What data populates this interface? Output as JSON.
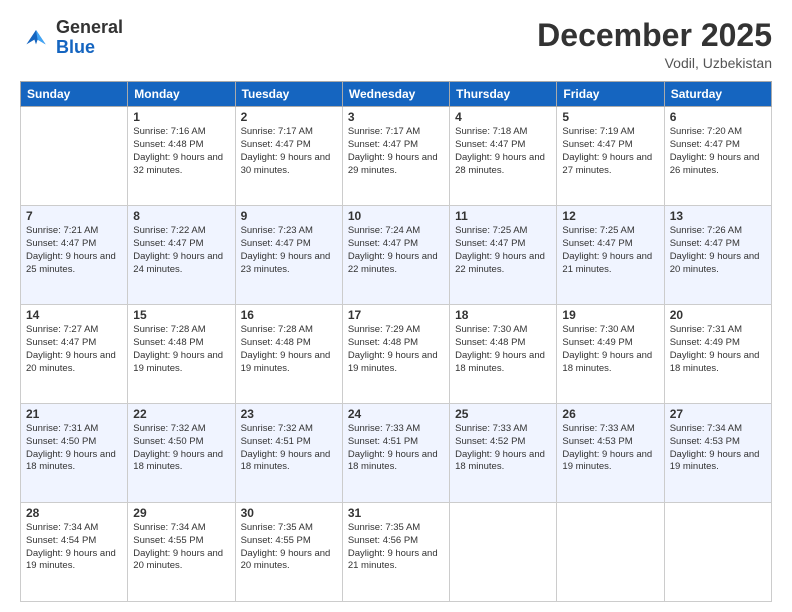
{
  "header": {
    "logo_general": "General",
    "logo_blue": "Blue",
    "month_title": "December 2025",
    "location": "Vodil, Uzbekistan"
  },
  "days_of_week": [
    "Sunday",
    "Monday",
    "Tuesday",
    "Wednesday",
    "Thursday",
    "Friday",
    "Saturday"
  ],
  "weeks": [
    [
      {
        "day": "",
        "sunrise": "",
        "sunset": "",
        "daylight": ""
      },
      {
        "day": "1",
        "sunrise": "Sunrise: 7:16 AM",
        "sunset": "Sunset: 4:48 PM",
        "daylight": "Daylight: 9 hours and 32 minutes."
      },
      {
        "day": "2",
        "sunrise": "Sunrise: 7:17 AM",
        "sunset": "Sunset: 4:47 PM",
        "daylight": "Daylight: 9 hours and 30 minutes."
      },
      {
        "day": "3",
        "sunrise": "Sunrise: 7:17 AM",
        "sunset": "Sunset: 4:47 PM",
        "daylight": "Daylight: 9 hours and 29 minutes."
      },
      {
        "day": "4",
        "sunrise": "Sunrise: 7:18 AM",
        "sunset": "Sunset: 4:47 PM",
        "daylight": "Daylight: 9 hours and 28 minutes."
      },
      {
        "day": "5",
        "sunrise": "Sunrise: 7:19 AM",
        "sunset": "Sunset: 4:47 PM",
        "daylight": "Daylight: 9 hours and 27 minutes."
      },
      {
        "day": "6",
        "sunrise": "Sunrise: 7:20 AM",
        "sunset": "Sunset: 4:47 PM",
        "daylight": "Daylight: 9 hours and 26 minutes."
      }
    ],
    [
      {
        "day": "7",
        "sunrise": "Sunrise: 7:21 AM",
        "sunset": "Sunset: 4:47 PM",
        "daylight": "Daylight: 9 hours and 25 minutes."
      },
      {
        "day": "8",
        "sunrise": "Sunrise: 7:22 AM",
        "sunset": "Sunset: 4:47 PM",
        "daylight": "Daylight: 9 hours and 24 minutes."
      },
      {
        "day": "9",
        "sunrise": "Sunrise: 7:23 AM",
        "sunset": "Sunset: 4:47 PM",
        "daylight": "Daylight: 9 hours and 23 minutes."
      },
      {
        "day": "10",
        "sunrise": "Sunrise: 7:24 AM",
        "sunset": "Sunset: 4:47 PM",
        "daylight": "Daylight: 9 hours and 22 minutes."
      },
      {
        "day": "11",
        "sunrise": "Sunrise: 7:25 AM",
        "sunset": "Sunset: 4:47 PM",
        "daylight": "Daylight: 9 hours and 22 minutes."
      },
      {
        "day": "12",
        "sunrise": "Sunrise: 7:25 AM",
        "sunset": "Sunset: 4:47 PM",
        "daylight": "Daylight: 9 hours and 21 minutes."
      },
      {
        "day": "13",
        "sunrise": "Sunrise: 7:26 AM",
        "sunset": "Sunset: 4:47 PM",
        "daylight": "Daylight: 9 hours and 20 minutes."
      }
    ],
    [
      {
        "day": "14",
        "sunrise": "Sunrise: 7:27 AM",
        "sunset": "Sunset: 4:47 PM",
        "daylight": "Daylight: 9 hours and 20 minutes."
      },
      {
        "day": "15",
        "sunrise": "Sunrise: 7:28 AM",
        "sunset": "Sunset: 4:48 PM",
        "daylight": "Daylight: 9 hours and 19 minutes."
      },
      {
        "day": "16",
        "sunrise": "Sunrise: 7:28 AM",
        "sunset": "Sunset: 4:48 PM",
        "daylight": "Daylight: 9 hours and 19 minutes."
      },
      {
        "day": "17",
        "sunrise": "Sunrise: 7:29 AM",
        "sunset": "Sunset: 4:48 PM",
        "daylight": "Daylight: 9 hours and 19 minutes."
      },
      {
        "day": "18",
        "sunrise": "Sunrise: 7:30 AM",
        "sunset": "Sunset: 4:48 PM",
        "daylight": "Daylight: 9 hours and 18 minutes."
      },
      {
        "day": "19",
        "sunrise": "Sunrise: 7:30 AM",
        "sunset": "Sunset: 4:49 PM",
        "daylight": "Daylight: 9 hours and 18 minutes."
      },
      {
        "day": "20",
        "sunrise": "Sunrise: 7:31 AM",
        "sunset": "Sunset: 4:49 PM",
        "daylight": "Daylight: 9 hours and 18 minutes."
      }
    ],
    [
      {
        "day": "21",
        "sunrise": "Sunrise: 7:31 AM",
        "sunset": "Sunset: 4:50 PM",
        "daylight": "Daylight: 9 hours and 18 minutes."
      },
      {
        "day": "22",
        "sunrise": "Sunrise: 7:32 AM",
        "sunset": "Sunset: 4:50 PM",
        "daylight": "Daylight: 9 hours and 18 minutes."
      },
      {
        "day": "23",
        "sunrise": "Sunrise: 7:32 AM",
        "sunset": "Sunset: 4:51 PM",
        "daylight": "Daylight: 9 hours and 18 minutes."
      },
      {
        "day": "24",
        "sunrise": "Sunrise: 7:33 AM",
        "sunset": "Sunset: 4:51 PM",
        "daylight": "Daylight: 9 hours and 18 minutes."
      },
      {
        "day": "25",
        "sunrise": "Sunrise: 7:33 AM",
        "sunset": "Sunset: 4:52 PM",
        "daylight": "Daylight: 9 hours and 18 minutes."
      },
      {
        "day": "26",
        "sunrise": "Sunrise: 7:33 AM",
        "sunset": "Sunset: 4:53 PM",
        "daylight": "Daylight: 9 hours and 19 minutes."
      },
      {
        "day": "27",
        "sunrise": "Sunrise: 7:34 AM",
        "sunset": "Sunset: 4:53 PM",
        "daylight": "Daylight: 9 hours and 19 minutes."
      }
    ],
    [
      {
        "day": "28",
        "sunrise": "Sunrise: 7:34 AM",
        "sunset": "Sunset: 4:54 PM",
        "daylight": "Daylight: 9 hours and 19 minutes."
      },
      {
        "day": "29",
        "sunrise": "Sunrise: 7:34 AM",
        "sunset": "Sunset: 4:55 PM",
        "daylight": "Daylight: 9 hours and 20 minutes."
      },
      {
        "day": "30",
        "sunrise": "Sunrise: 7:35 AM",
        "sunset": "Sunset: 4:55 PM",
        "daylight": "Daylight: 9 hours and 20 minutes."
      },
      {
        "day": "31",
        "sunrise": "Sunrise: 7:35 AM",
        "sunset": "Sunset: 4:56 PM",
        "daylight": "Daylight: 9 hours and 21 minutes."
      },
      {
        "day": "",
        "sunrise": "",
        "sunset": "",
        "daylight": ""
      },
      {
        "day": "",
        "sunrise": "",
        "sunset": "",
        "daylight": ""
      },
      {
        "day": "",
        "sunrise": "",
        "sunset": "",
        "daylight": ""
      }
    ]
  ]
}
